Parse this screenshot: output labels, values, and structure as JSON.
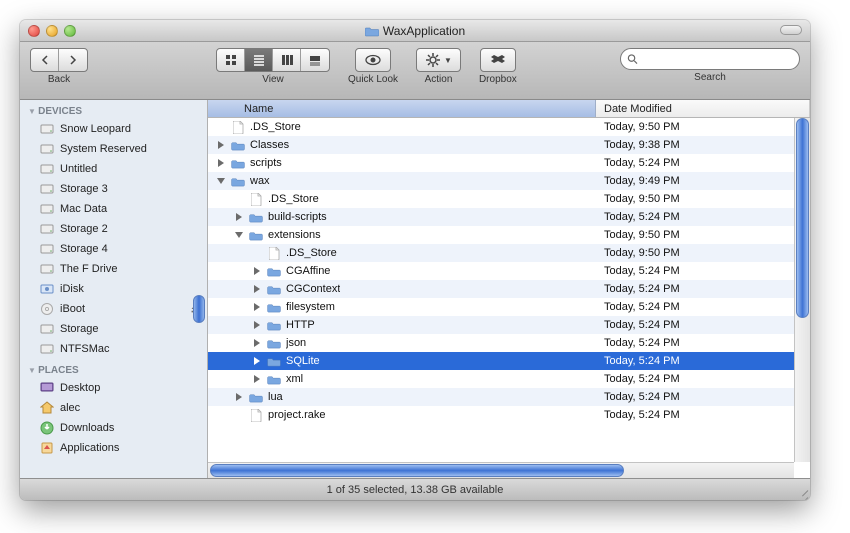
{
  "window": {
    "title": "WaxApplication"
  },
  "toolbar": {
    "back_label": "Back",
    "view_label": "View",
    "quicklook_label": "Quick Look",
    "action_label": "Action",
    "dropbox_label": "Dropbox",
    "search_label": "Search",
    "search_placeholder": ""
  },
  "sidebar": {
    "sections": [
      {
        "title": "DEVICES",
        "items": [
          {
            "icon": "hdd",
            "label": "Snow Leopard"
          },
          {
            "icon": "hdd",
            "label": "System Reserved"
          },
          {
            "icon": "hdd",
            "label": "Untitled"
          },
          {
            "icon": "hdd",
            "label": "Storage 3"
          },
          {
            "icon": "hdd",
            "label": "Mac Data"
          },
          {
            "icon": "hdd",
            "label": "Storage 2"
          },
          {
            "icon": "hdd",
            "label": "Storage 4"
          },
          {
            "icon": "hdd",
            "label": "The F Drive"
          },
          {
            "icon": "idisk",
            "label": "iDisk"
          },
          {
            "icon": "disc",
            "label": "iBoot",
            "eject": true
          },
          {
            "icon": "hdd",
            "label": "Storage"
          },
          {
            "icon": "hdd",
            "label": "NTFSMac"
          }
        ]
      },
      {
        "title": "PLACES",
        "items": [
          {
            "icon": "desktop",
            "label": "Desktop"
          },
          {
            "icon": "home",
            "label": "alec"
          },
          {
            "icon": "downloads",
            "label": "Downloads"
          },
          {
            "icon": "apps",
            "label": "Applications"
          }
        ]
      }
    ]
  },
  "columns": {
    "name": "Name",
    "date": "Date Modified"
  },
  "rows": [
    {
      "depth": 0,
      "type": "file",
      "expand": "none",
      "name": ".DS_Store",
      "date": "Today, 9:50 PM"
    },
    {
      "depth": 0,
      "type": "folder",
      "expand": "closed",
      "name": "Classes",
      "date": "Today, 9:38 PM"
    },
    {
      "depth": 0,
      "type": "folder",
      "expand": "closed",
      "name": "scripts",
      "date": "Today, 5:24 PM"
    },
    {
      "depth": 0,
      "type": "folder",
      "expand": "open",
      "name": "wax",
      "date": "Today, 9:49 PM"
    },
    {
      "depth": 1,
      "type": "file",
      "expand": "none",
      "name": ".DS_Store",
      "date": "Today, 9:50 PM"
    },
    {
      "depth": 1,
      "type": "folder",
      "expand": "closed",
      "name": "build-scripts",
      "date": "Today, 5:24 PM"
    },
    {
      "depth": 1,
      "type": "folder",
      "expand": "open",
      "name": "extensions",
      "date": "Today, 9:50 PM"
    },
    {
      "depth": 2,
      "type": "file",
      "expand": "none",
      "name": ".DS_Store",
      "date": "Today, 9:50 PM"
    },
    {
      "depth": 2,
      "type": "folder",
      "expand": "closed",
      "name": "CGAffine",
      "date": "Today, 5:24 PM"
    },
    {
      "depth": 2,
      "type": "folder",
      "expand": "closed",
      "name": "CGContext",
      "date": "Today, 5:24 PM"
    },
    {
      "depth": 2,
      "type": "folder",
      "expand": "closed",
      "name": "filesystem",
      "date": "Today, 5:24 PM"
    },
    {
      "depth": 2,
      "type": "folder",
      "expand": "closed",
      "name": "HTTP",
      "date": "Today, 5:24 PM"
    },
    {
      "depth": 2,
      "type": "folder",
      "expand": "closed",
      "name": "json",
      "date": "Today, 5:24 PM"
    },
    {
      "depth": 2,
      "type": "folder",
      "expand": "closed",
      "name": "SQLite",
      "date": "Today, 5:24 PM",
      "selected": true
    },
    {
      "depth": 2,
      "type": "folder",
      "expand": "closed",
      "name": "xml",
      "date": "Today, 5:24 PM"
    },
    {
      "depth": 1,
      "type": "folder",
      "expand": "closed",
      "name": "lua",
      "date": "Today, 5:24 PM"
    },
    {
      "depth": 1,
      "type": "file",
      "expand": "none",
      "name": "project.rake",
      "date": "Today, 5:24 PM"
    }
  ],
  "status": "1 of 35 selected, 13.38 GB available"
}
